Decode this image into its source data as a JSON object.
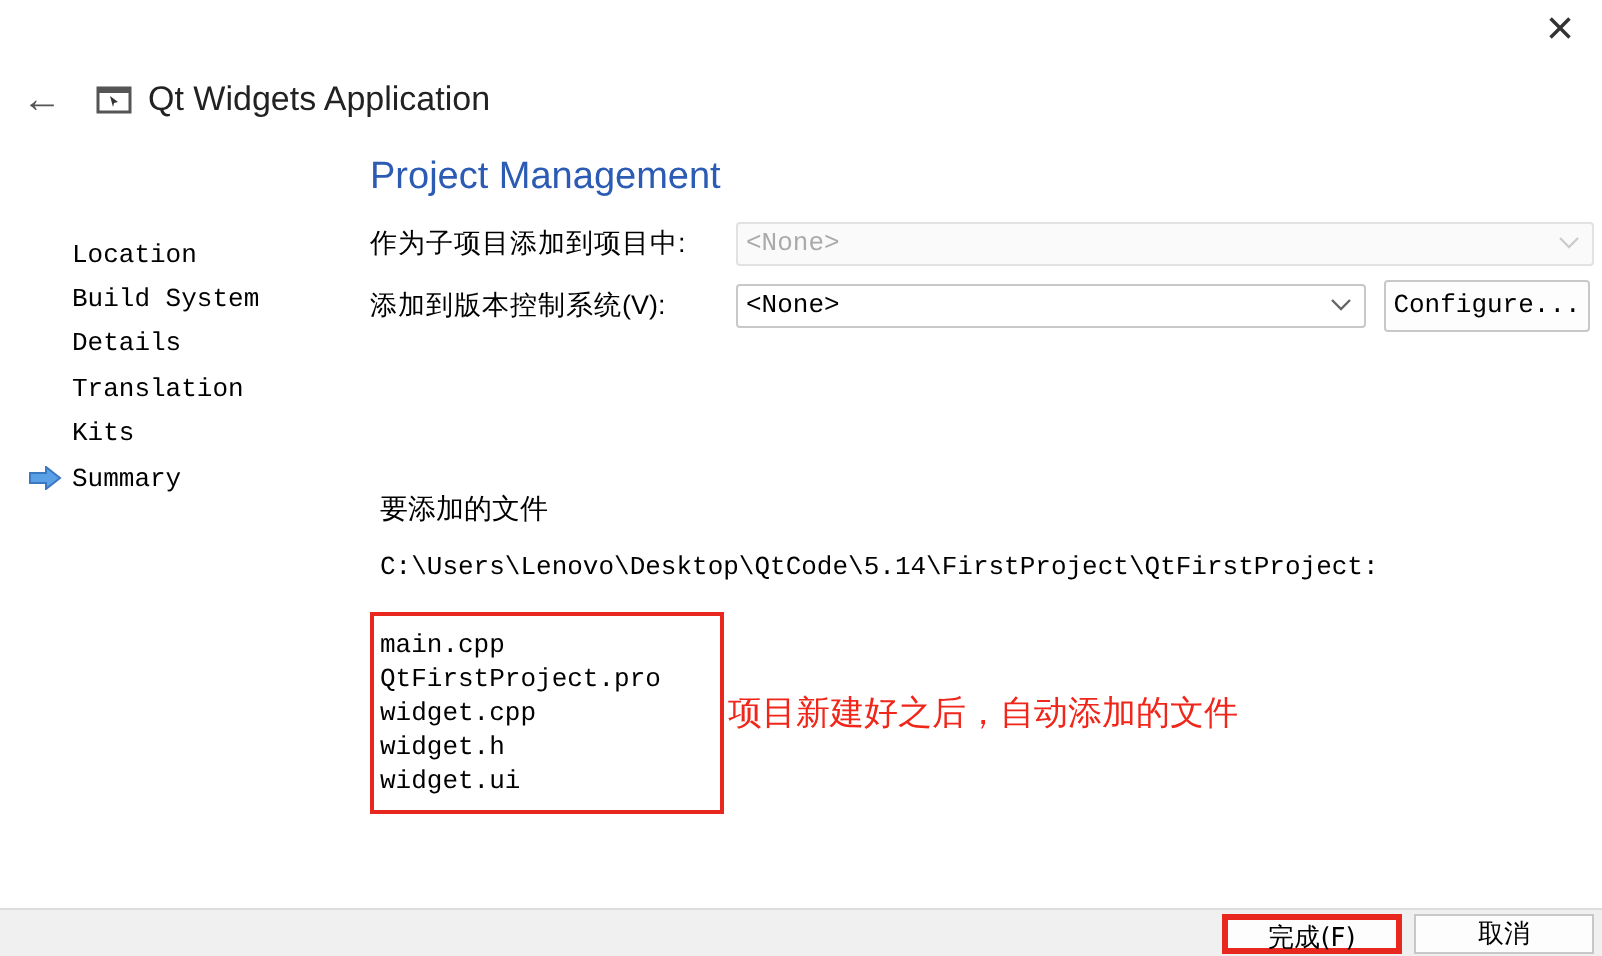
{
  "window": {
    "close": "×",
    "back": "←",
    "title": "Qt Widgets Application"
  },
  "sidebar": {
    "items": [
      {
        "label": "Location",
        "selected": false
      },
      {
        "label": "Build System",
        "selected": false
      },
      {
        "label": "Details",
        "selected": false
      },
      {
        "label": "Translation",
        "selected": false
      },
      {
        "label": "Kits",
        "selected": false
      },
      {
        "label": "Summary",
        "selected": true
      }
    ]
  },
  "page": {
    "heading": "Project Management",
    "fields": [
      {
        "label": "作为子项目添加到项目中:",
        "value": "<None>",
        "disabled": true
      },
      {
        "label": "添加到版本控制系统(V):",
        "value": "<None>",
        "disabled": false,
        "button": "Configure..."
      }
    ],
    "files_label": "要添加的文件",
    "path": "C:\\Users\\Lenovo\\Desktop\\QtCode\\5.14\\FirstProject\\QtFirstProject:",
    "files": [
      "main.cpp",
      "QtFirstProject.pro",
      "widget.cpp",
      "widget.h",
      "widget.ui"
    ],
    "annotation": "项目新建好之后，自动添加的文件"
  },
  "footer": {
    "buttons": [
      {
        "label": "完成(F)",
        "highlighted": true
      },
      {
        "label": "取消",
        "highlighted": false
      }
    ]
  }
}
